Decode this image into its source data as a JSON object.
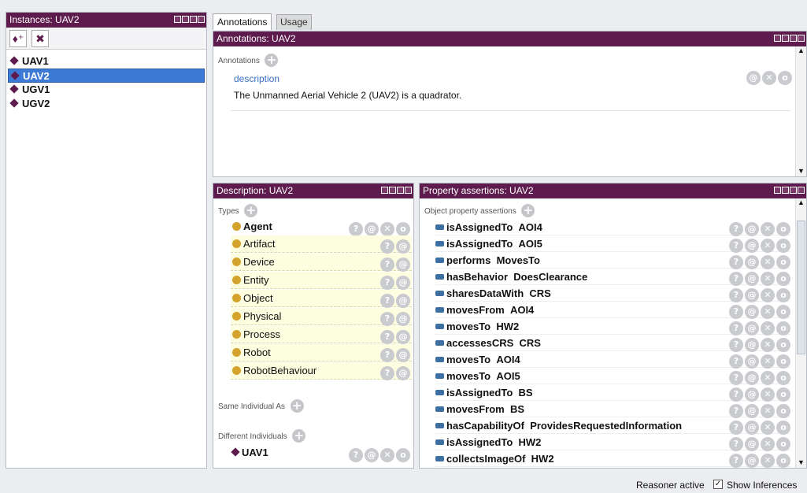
{
  "instances_panel": {
    "title": "Instances: UAV2",
    "items": [
      {
        "label": "UAV1",
        "selected": false
      },
      {
        "label": "UAV2",
        "selected": true
      },
      {
        "label": "UGV1",
        "selected": false
      },
      {
        "label": "UGV2",
        "selected": false
      }
    ]
  },
  "tabs": [
    {
      "label": "Annotations",
      "active": true
    },
    {
      "label": "Usage",
      "active": false
    }
  ],
  "annotations_panel": {
    "title": "Annotations: UAV2",
    "section_label": "Annotations",
    "property": "description",
    "value": "The Unmanned Aerial Vehicle 2 (UAV2) is a quadrator."
  },
  "description_panel": {
    "title": "Description: UAV2",
    "types_label": "Types",
    "types": [
      {
        "label": "Agent",
        "inferred": false
      },
      {
        "label": "Artifact",
        "inferred": true
      },
      {
        "label": "Device",
        "inferred": true
      },
      {
        "label": "Entity",
        "inferred": true
      },
      {
        "label": "Object",
        "inferred": true
      },
      {
        "label": "Physical",
        "inferred": true
      },
      {
        "label": "Process",
        "inferred": true
      },
      {
        "label": "Robot",
        "inferred": true
      },
      {
        "label": "RobotBehaviour",
        "inferred": true
      }
    ],
    "same_label": "Same Individual As",
    "different_label": "Different Individuals",
    "different": [
      "UAV1"
    ]
  },
  "property_panel": {
    "title": "Property assertions: UAV2",
    "section_label": "Object property assertions",
    "assertions": [
      {
        "prop": "isAssignedTo",
        "obj": "AOI4"
      },
      {
        "prop": "isAssignedTo",
        "obj": "AOI5"
      },
      {
        "prop": "performs",
        "obj": "MovesTo"
      },
      {
        "prop": "hasBehavior",
        "obj": "DoesClearance"
      },
      {
        "prop": "sharesDataWith",
        "obj": "CRS"
      },
      {
        "prop": "movesFrom",
        "obj": "AOI4"
      },
      {
        "prop": "movesTo",
        "obj": "HW2"
      },
      {
        "prop": "accessesCRS",
        "obj": "CRS"
      },
      {
        "prop": "movesTo",
        "obj": "AOI4"
      },
      {
        "prop": "movesTo",
        "obj": "AOI5"
      },
      {
        "prop": "isAssignedTo",
        "obj": "BS"
      },
      {
        "prop": "movesFrom",
        "obj": "BS"
      },
      {
        "prop": "hasCapabilityOf",
        "obj": "ProvidesRequestedInformation"
      },
      {
        "prop": "isAssignedTo",
        "obj": "HW2"
      },
      {
        "prop": "collectsImageOf",
        "obj": "HW2"
      }
    ]
  },
  "status": {
    "reasoner": "Reasoner active",
    "show_inferences": "Show Inferences",
    "show_inferences_checked": true
  },
  "icons": {
    "add": "+",
    "explain": "?",
    "annotate": "@",
    "delete": "✕",
    "edit": "o"
  },
  "colors": {
    "title_bar": "#5e1c4e",
    "selection": "#3d7ad6",
    "class_dot": "#d4a32c",
    "property_bar": "#3e6fa3",
    "inferred_bg": "#fdfde0"
  }
}
